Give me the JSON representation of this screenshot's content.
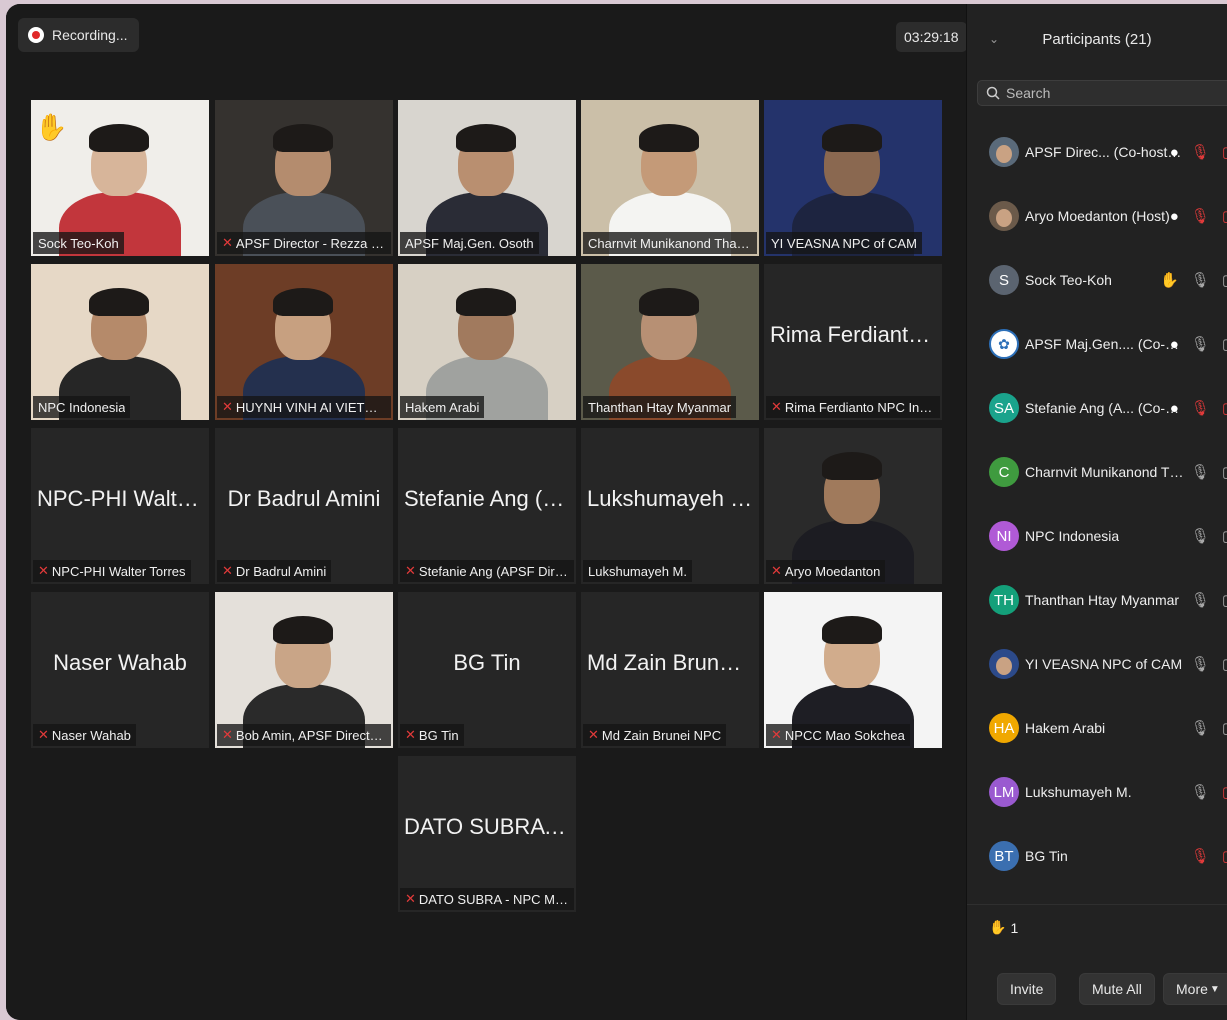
{
  "recording": {
    "label": "Recording..."
  },
  "timer": {
    "value": "03:29:18"
  },
  "tiles": [
    {
      "name": "Sock Teo-Koh",
      "muted": false,
      "video": true
    },
    {
      "name": "APSF Director - Rezza Bramm...",
      "muted": true,
      "video": true
    },
    {
      "name": "APSF Maj.Gen. Osoth",
      "muted": false,
      "video": true
    },
    {
      "name": "Charnvit Munikanond Thailand",
      "muted": false,
      "video": true
    },
    {
      "name": "YI VEASNA NPC of CAM",
      "muted": false,
      "video": true
    },
    {
      "name": "NPC Indonesia",
      "muted": false,
      "video": true
    },
    {
      "name": "HUYNH VINH AI VIETNAM",
      "muted": true,
      "video": true
    },
    {
      "name": "Hakem Arabi",
      "muted": false,
      "video": true
    },
    {
      "name": "Thanthan Htay Myanmar",
      "muted": false,
      "video": true
    },
    {
      "name": "Rima Ferdianto NPC Indonesia",
      "big": "Rima Ferdianto NP...",
      "muted": true,
      "video": false
    },
    {
      "name": "NPC-PHI Walter Torres",
      "big": "NPC-PHI Walter Tor...",
      "muted": true,
      "video": false
    },
    {
      "name": "Dr Badrul Amini",
      "big": "Dr Badrul Amini",
      "muted": true,
      "video": false
    },
    {
      "name": "Stefanie Ang (APSF Director, S...",
      "big": "Stefanie Ang (APSF...",
      "muted": true,
      "video": false
    },
    {
      "name": "Lukshumayeh M.",
      "big": "Lukshumayeh M.",
      "muted": false,
      "video": false
    },
    {
      "name": "Aryo Moedanton",
      "muted": true,
      "video": true
    },
    {
      "name": "Naser Wahab",
      "big": "Naser Wahab",
      "muted": true,
      "video": false
    },
    {
      "name": "Bob Amin, APSF Director, Even...",
      "muted": true,
      "video": true
    },
    {
      "name": "BG Tin",
      "big": "BG Tin",
      "muted": true,
      "video": false
    },
    {
      "name": "Md Zain Brunei NPC",
      "big": "Md Zain Brunei NPC",
      "muted": true,
      "video": false
    },
    {
      "name": "NPCC Mao Sokchea",
      "muted": true,
      "video": true
    },
    {
      "name": "DATO SUBRA - NPC MAS",
      "big": "DATO SUBRA - NP...",
      "muted": true,
      "video": false
    }
  ],
  "sidebar": {
    "title": "Participants (21)",
    "search_placeholder": "Search",
    "participants": [
      {
        "name": "APSF Direc...  (Co-host, me)",
        "initials": "",
        "color": "#5a6a7a",
        "rec": true,
        "hand": false,
        "mic": "muted",
        "cam": "off"
      },
      {
        "name": "Aryo Moedanton (Host)",
        "initials": "",
        "color": "#6b5a4a",
        "rec": true,
        "hand": false,
        "mic": "muted",
        "cam": "off"
      },
      {
        "name": "Sock Teo-Koh",
        "initials": "S",
        "color": "#5b6470",
        "rec": false,
        "hand": true,
        "mic": "on",
        "cam": "on"
      },
      {
        "name": "APSF Maj.Gen....  (Co-host)",
        "initials": "",
        "color": "#ffffff",
        "rec": true,
        "hand": false,
        "mic": "on",
        "cam": "on"
      },
      {
        "name": "Stefanie Ang (A...  (Co-host)",
        "initials": "SA",
        "color": "#1aa38c",
        "rec": true,
        "hand": false,
        "mic": "muted",
        "cam": "off"
      },
      {
        "name": "Charnvit Munikanond Thailand",
        "initials": "C",
        "color": "#3f9b3f",
        "rec": false,
        "hand": false,
        "mic": "on",
        "cam": "on"
      },
      {
        "name": "NPC Indonesia",
        "initials": "NI",
        "color": "#b05ad6",
        "rec": false,
        "hand": false,
        "mic": "on",
        "cam": "on"
      },
      {
        "name": "Thanthan Htay Myanmar",
        "initials": "TH",
        "color": "#14a07a",
        "rec": false,
        "hand": false,
        "mic": "on",
        "cam": "on"
      },
      {
        "name": "YI VEASNA NPC of CAM",
        "initials": "",
        "color": "#2c4a8a",
        "rec": false,
        "hand": false,
        "mic": "on",
        "cam": "on"
      },
      {
        "name": "Hakem Arabi",
        "initials": "HA",
        "color": "#f0a800",
        "rec": false,
        "hand": false,
        "mic": "on",
        "cam": "on"
      },
      {
        "name": "Lukshumayeh M.",
        "initials": "LM",
        "color": "#9a5ad0",
        "rec": false,
        "hand": false,
        "mic": "on",
        "cam": "off"
      },
      {
        "name": "BG Tin",
        "initials": "BT",
        "color": "#3b6fb0",
        "rec": false,
        "hand": false,
        "mic": "muted",
        "cam": "off"
      }
    ],
    "raised_count": "1",
    "buttons": {
      "invite": "Invite",
      "mute_all": "Mute All",
      "more": "More"
    }
  },
  "colors": {
    "muted": "#e03a3a",
    "hand": "#f4b400",
    "active_speaker": "#b8b54a"
  }
}
